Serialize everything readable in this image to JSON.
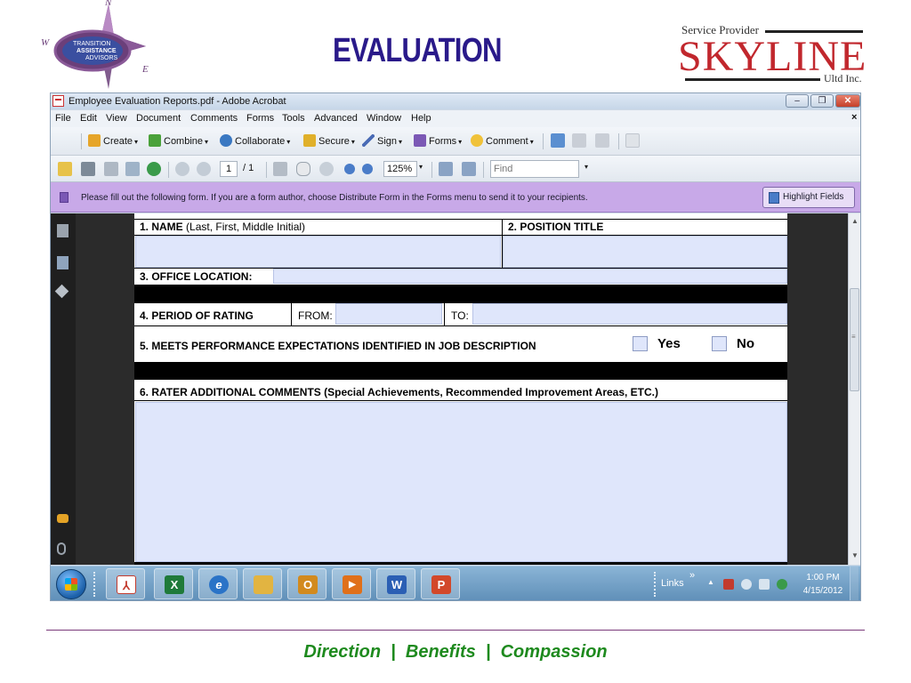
{
  "slide": {
    "title": "EVALUATION",
    "tagline": "Direction  |  Benefits  |  Compassion"
  },
  "logo_left": {
    "compass_n": "N",
    "compass_w": "W",
    "compass_e": "E",
    "line1": "TRANSITION",
    "line2": "ASSISTANCE",
    "line3": "ADVISORS"
  },
  "logo_right": {
    "service_provider": "Service Provider",
    "name": "SKYLINE",
    "suffix": "Ultd Inc."
  },
  "window": {
    "title": "Employee Evaluation Reports.pdf - Adobe Acrobat",
    "min": "–",
    "max": "❐",
    "close": "✕"
  },
  "menu": [
    "File",
    "Edit",
    "View",
    "Document",
    "Comments",
    "Forms",
    "Tools",
    "Advanced",
    "Window",
    "Help"
  ],
  "toolbar1": {
    "create": "Create",
    "combine": "Combine",
    "collaborate": "Collaborate",
    "secure": "Secure",
    "sign": "Sign",
    "forms": "Forms",
    "comment": "Comment"
  },
  "toolbar2": {
    "page_current": "1",
    "page_total": "/ 1",
    "zoom": "125%",
    "find_placeholder": "Find"
  },
  "formbar": {
    "message": "Please fill out the following form. If you are a form author, choose Distribute Form in the Forms menu to send it to your recipients.",
    "highlight_button": "Highlight Fields"
  },
  "form": {
    "name_label_bold": "1. NAME",
    "name_label_rest": " (Last, First, Middle Initial)",
    "position_label": "2. POSITION TITLE",
    "office_label": "3. OFFICE LOCATION:",
    "period_label": "4. PERIOD OF RATING",
    "from_label": "FROM:",
    "to_label": "TO:",
    "meets_label": "5. MEETS PERFORMANCE EXPECTATIONS IDENTIFIED IN JOB DESCRIPTION",
    "yes_label": "Yes",
    "no_label": "No",
    "comments_label": "6.  RATER ADDITIONAL COMMENTS (Special Achievements, Recommended Improvement Areas, ETC.)"
  },
  "taskbar": {
    "links": "Links",
    "links_chevron": "»",
    "time": "1:00 PM",
    "date": "4/15/2012",
    "apps": [
      {
        "name": "Adobe Acrobat",
        "glyph": "⅄",
        "color": "#c33b2e"
      },
      {
        "name": "Excel",
        "glyph": "X",
        "color": "#1f7a3a"
      },
      {
        "name": "Internet Explorer",
        "glyph": "e",
        "color": "#2a73c7"
      },
      {
        "name": "Windows Explorer",
        "glyph": "",
        "color": "#e2b441"
      },
      {
        "name": "Outlook",
        "glyph": "O",
        "color": "#d28a1e"
      },
      {
        "name": "Media Player",
        "glyph": "▶",
        "color": "#e0701a"
      },
      {
        "name": "Word",
        "glyph": "W",
        "color": "#2b5fb4"
      },
      {
        "name": "PowerPoint",
        "glyph": "P",
        "color": "#d2482a"
      }
    ]
  },
  "colors": {
    "title": "#2a1a8a",
    "skyline": "#c1272d",
    "tagline": "#1e8a1e",
    "formbar": "#c8a9e8",
    "form_field": "#dfe6fb"
  }
}
